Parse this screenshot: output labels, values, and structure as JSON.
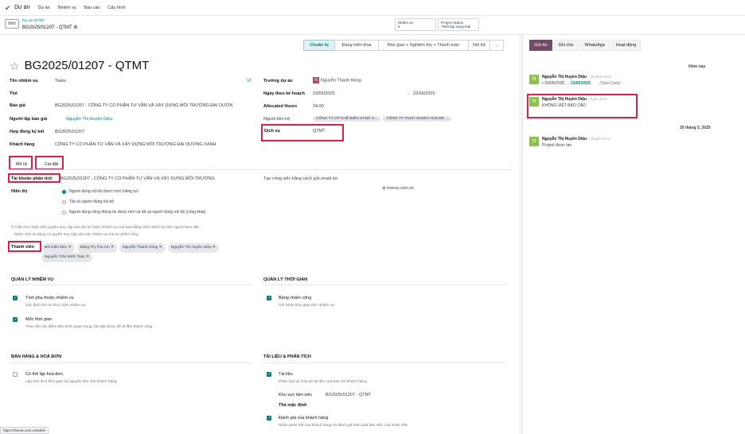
{
  "topbar": {
    "app_title": "Dự án",
    "menu": [
      "Dự án",
      "Nhiệm vụ",
      "Báo cáo",
      "Cấu hình"
    ]
  },
  "breadcrumb": {
    "new_label": "Mới",
    "parent": "Dự án QTMT",
    "current": "BG2025/01207 - QTMT"
  },
  "stat_buttons": [
    {
      "label": "Nhiệm vụ",
      "value": "6"
    },
    {
      "label": "Project Status",
      "value": "Thiết lập trạng thái"
    }
  ],
  "stages": [
    "Chuẩn bị",
    "Đang triển khai",
    "Bàn giao + Nghiệm thu + Thanh toán",
    "Nội bộ",
    "..."
  ],
  "task": {
    "title": "BG2025/01207 - QTMT",
    "fields_left": [
      {
        "label": "Tên nhiệm vụ",
        "value": "Tasks"
      },
      {
        "label": "Thẻ",
        "value": ""
      },
      {
        "label": "Báo giá",
        "value": "BG2025/01207 - CÔNG TY CỔ PHẦN TƯ VẤN VÀ XÂY DỰNG MÔI TRƯỜNG ĐẠI DƯƠN"
      },
      {
        "label": "Người lập báo giá",
        "value": "Nguyễn Thị Huyền Diệu"
      },
      {
        "label": "Hợp đồng ký kết",
        "value": "BG2025/01207"
      },
      {
        "label": "Khách hàng",
        "value": "CÔNG TY CỔ PHẦN TƯ VẤN VÀ XÂY DỰNG MÔI TRƯỜNG ĐẠI DƯƠNG XANH"
      }
    ],
    "lang_tag": "VI",
    "fields_right": {
      "manager_label": "Trưởng dự án",
      "manager_value": "Nguyễn Thanh Hùng",
      "manager_initial": "N",
      "planned_date_label": "Ngày theo kế hoạch",
      "date_start": "23/05/2025",
      "date_end": "22/06/2025",
      "date_arrow": "→",
      "hours_label": "Allocated Hours",
      "hours_value": "24:00",
      "contact_label": "Người liên hệ",
      "contacts": [
        "CÔNG TY CP CHẾ BIẾN HÀNG X...",
        "CÔNG TY TNHH SUNNY HOUSE ..."
      ],
      "service_label": "Dịch vụ",
      "service_value": "QTMT"
    }
  },
  "tabs": [
    "Mô tả",
    "Cài đặt"
  ],
  "settings": {
    "analytic_label": "Tài khoản phân tích",
    "analytic_value": "BG2025/01207 - CÔNG TY CỔ PHẦN TƯ VẤN VÀ XÂY DỰNG MÔI TRƯỜNG",
    "email_label": "Tạo công việc bằng cách gửi email tới",
    "email_value": "hseva.com.vn",
    "visibility_label": "Hiển thị",
    "visibility_options": [
      "Người dùng nội bộ được mời (riêng tư)",
      "Tất cả người dùng nội bộ",
      "Người dùng cổng thông tin được mời và tất cả người dùng nội bộ (công khai)"
    ],
    "visibility_selected": 0,
    "note_line1": "Cấp cho nhân viên quyền truy cập vào dự án hoặc nhiệm vụ của bạn bằng cách thêm họ làm người theo dõi.",
    "note_line2": "Nhân viên tự động có quyền truy cập vào các nhiệm vụ mà họ phân công.",
    "members_label": "Thành viên",
    "members": [
      "Bùi Kiến Đức",
      "Đặng Thị Thu Am",
      "Nguyễn Thanh Hùng",
      "Nguyễn Thị Huyền Diệu",
      "Nguyễn Trần Minh Toàn"
    ],
    "sections": {
      "task_mgmt": {
        "title": "QUẢN LÝ NHIỆM VỤ",
        "options": [
          {
            "title": "Tính phụ thuộc nhiệm vụ",
            "desc": "Xác định thứ tự thực hiện nhiệm vụ",
            "checked": true
          },
          {
            "title": "Mốc thời gian",
            "desc": "Theo dõi các điểm tiến trình quan trọng cần đạt được để đi đến thành công",
            "checked": true
          }
        ]
      },
      "time_mgmt": {
        "title": "QUẢN LÝ THỜI GIAN",
        "options": [
          {
            "title": "Bảng chấm công",
            "desc": "Ghi nhận thời gian trên nhiệm vụ",
            "checked": true
          }
        ]
      },
      "sales": {
        "title": "BÁN HÀNG & HOÁ ĐƠN",
        "options": [
          {
            "title": "Có thể lập hóa đơn",
            "desc": "Lập hóa đơn thời gian và nguyên liệu cho khách hàng",
            "checked": false
          }
        ]
      },
      "docs": {
        "title": "TÀI LIỆU & PHÂN TÍCH",
        "options": [
          {
            "title": "Tài liệu",
            "desc": "Phân loại và chia sẻ tài liệu của bạn với khách hàng",
            "checked": true
          },
          {
            "title": "Đánh giá của khách hàng",
            "desc": "Nhận phản hồi của khách hàng và đánh giá hiệu quả làm việc của nhân viên",
            "checked": true
          }
        ],
        "workspace_label": "Khu vực làm việc",
        "workspace_value": "BG2025/01207 - QTMT",
        "default_tag_label": "Thẻ mặc định"
      }
    }
  },
  "chatter": {
    "buttons": [
      "Gửi tin",
      "Ghi chú",
      "WhatsApp",
      "Hoạt động"
    ],
    "date_today": "Hôm nay",
    "date_past": "30 tháng 5, 2025",
    "messages": [
      {
        "author": "Nguyễn Thị Huyền Diệu",
        "time": "- 30 phút trước",
        "line": "30/05/2025",
        "arrow": "→",
        "new_value": "23/05/2025",
        "field": "(Start Date)",
        "initial": "N"
      },
      {
        "author": "Nguyễn Thị Huyền Diệu",
        "time": "- 6 giờ trước",
        "body": "KHÔNG VIẾT BÁO CÁO",
        "initial": "N"
      },
      {
        "author": "Nguyễn Thị Huyền Diệu",
        "time": "- 20 giờ trước",
        "body": "Project được tạo",
        "initial": "N"
      }
    ]
  },
  "status_url": "https://hseva.com.vn/web#"
}
